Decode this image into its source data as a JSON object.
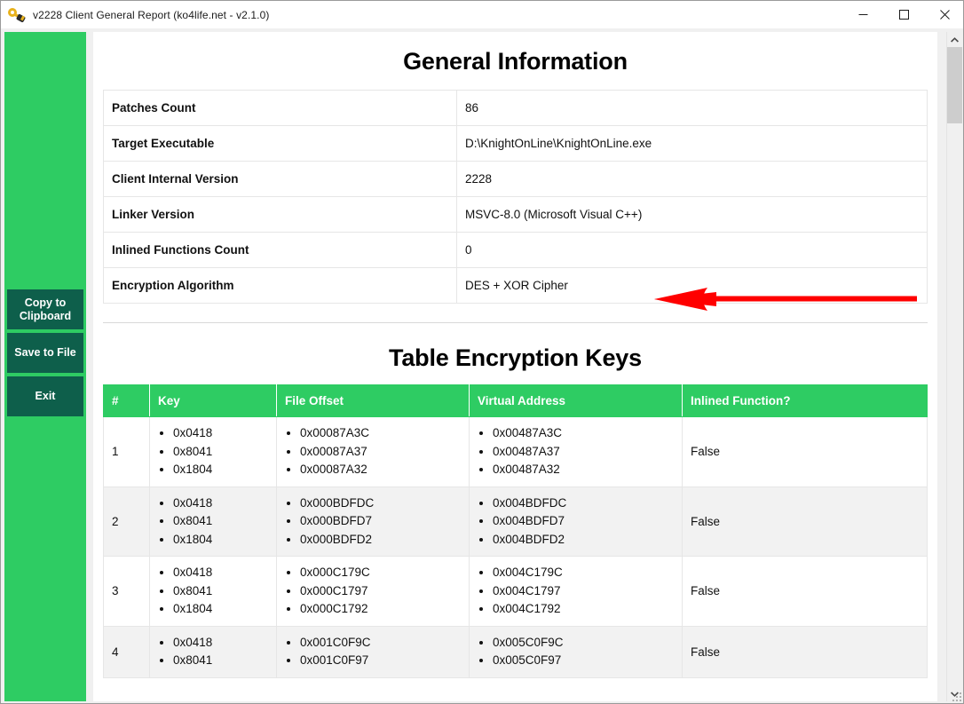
{
  "window": {
    "title": "v2228 Client General Report (ko4life.net - v2.1.0)",
    "icon": "key-icon",
    "controls": {
      "minimize": "minimize-icon",
      "maximize": "maximize-icon",
      "close": "close-icon"
    }
  },
  "theme": {
    "sidebar_green": "#2ecc63",
    "button_dark_teal": "#0e5f4b",
    "header_green": "#2ecc63",
    "annotation_red": "#ff0000",
    "zebra_gray": "#f2f2f2"
  },
  "sidebar": {
    "buttons": [
      {
        "label": "Copy to Clipboard",
        "name": "copy-to-clipboard-button"
      },
      {
        "label": "Save to File",
        "name": "save-to-file-button"
      },
      {
        "label": "Exit",
        "name": "exit-button"
      }
    ]
  },
  "general_information": {
    "title": "General Information",
    "rows": [
      {
        "label": "Patches Count",
        "value": "86"
      },
      {
        "label": "Target Executable",
        "value": "D:\\KnightOnLine\\KnightOnLine.exe"
      },
      {
        "label": "Client Internal Version",
        "value": "2228"
      },
      {
        "label": "Linker Version",
        "value": "MSVC-8.0 (Microsoft Visual C++)"
      },
      {
        "label": "Inlined Functions Count",
        "value": "0"
      },
      {
        "label": "Encryption Algorithm",
        "value": "DES + XOR Cipher"
      }
    ]
  },
  "annotation": {
    "type": "left-pointing-arrow",
    "points_at": "Encryption Algorithm",
    "color": "#ff0000"
  },
  "table_encryption_keys": {
    "title": "Table Encryption Keys",
    "columns": [
      "#",
      "Key",
      "File Offset",
      "Virtual Address",
      "Inlined Function?"
    ],
    "rows": [
      {
        "index": "1",
        "keys": [
          "0x0418",
          "0x8041",
          "0x1804"
        ],
        "file_offsets": [
          "0x00087A3C",
          "0x00087A37",
          "0x00087A32"
        ],
        "virtual_addresses": [
          "0x00487A3C",
          "0x00487A37",
          "0x00487A32"
        ],
        "inlined": "False"
      },
      {
        "index": "2",
        "keys": [
          "0x0418",
          "0x8041",
          "0x1804"
        ],
        "file_offsets": [
          "0x000BDFDC",
          "0x000BDFD7",
          "0x000BDFD2"
        ],
        "virtual_addresses": [
          "0x004BDFDC",
          "0x004BDFD7",
          "0x004BDFD2"
        ],
        "inlined": "False"
      },
      {
        "index": "3",
        "keys": [
          "0x0418",
          "0x8041",
          "0x1804"
        ],
        "file_offsets": [
          "0x000C179C",
          "0x000C1797",
          "0x000C1792"
        ],
        "virtual_addresses": [
          "0x004C179C",
          "0x004C1797",
          "0x004C1792"
        ],
        "inlined": "False"
      },
      {
        "index": "4",
        "keys": [
          "0x0418",
          "0x8041"
        ],
        "file_offsets": [
          "0x001C0F9C",
          "0x001C0F97"
        ],
        "virtual_addresses": [
          "0x005C0F9C",
          "0x005C0F97"
        ],
        "inlined": "False"
      }
    ]
  },
  "scrollbar": {
    "up_arrow": "chevron-up-icon",
    "down_arrow": "chevron-down-icon",
    "thumb_position_percent": 0,
    "thumb_size_percent": 12
  }
}
